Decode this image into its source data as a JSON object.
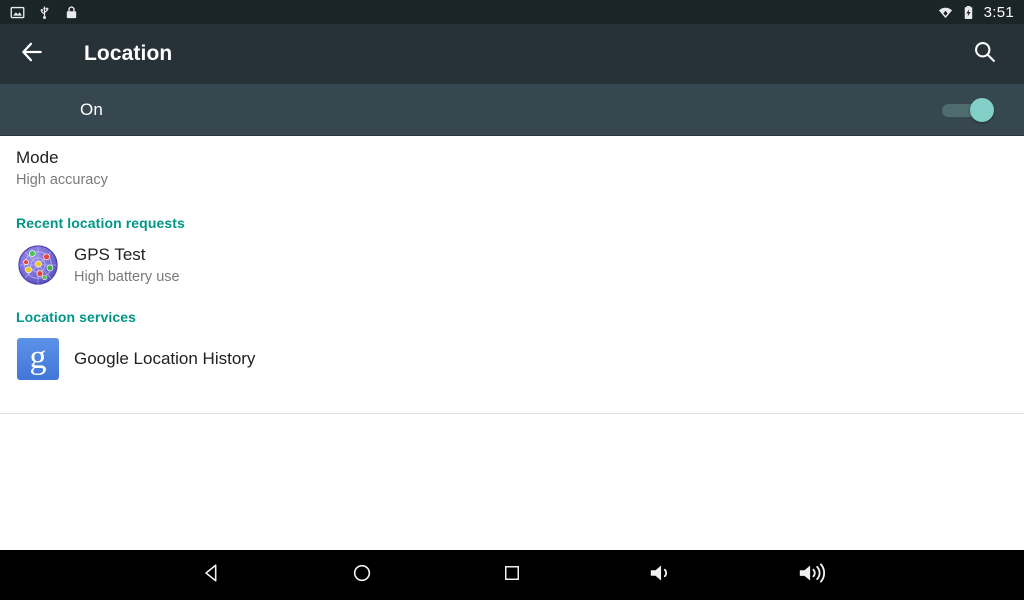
{
  "status_bar": {
    "icons": [
      "screenshot-icon",
      "usb-icon",
      "lock-icon"
    ],
    "right_icons": [
      "wifi-icon",
      "battery-charging-icon"
    ],
    "clock": "3:51"
  },
  "action_bar": {
    "back_icon": "arrow-back-icon",
    "title": "Location",
    "search_icon": "search-icon"
  },
  "switch_bar": {
    "label": "On",
    "state": "on",
    "thumb_color": "#81cfc6",
    "track_color": "#4e6b6d",
    "background": "#37474f"
  },
  "preferences": {
    "mode": {
      "title": "Mode",
      "summary": "High accuracy"
    }
  },
  "sections": {
    "recent_requests": {
      "header": "Recent location requests",
      "items": [
        {
          "icon": "gps-test-radar-icon",
          "title": "GPS Test",
          "summary": "High battery use"
        }
      ]
    },
    "location_services": {
      "header": "Location services",
      "items": [
        {
          "icon": "google-g-icon",
          "glyph": "g",
          "title": "Google Location History",
          "summary": ""
        }
      ]
    }
  },
  "nav_bar": {
    "buttons": [
      {
        "name": "back-nav-icon"
      },
      {
        "name": "home-nav-icon"
      },
      {
        "name": "recents-nav-icon"
      },
      {
        "name": "volume-down-icon"
      },
      {
        "name": "volume-up-icon"
      }
    ]
  },
  "colors": {
    "accent": "#009688",
    "action_bar": "#263238",
    "status_bar": "#1b2427",
    "switch_bar": "#37474f"
  }
}
